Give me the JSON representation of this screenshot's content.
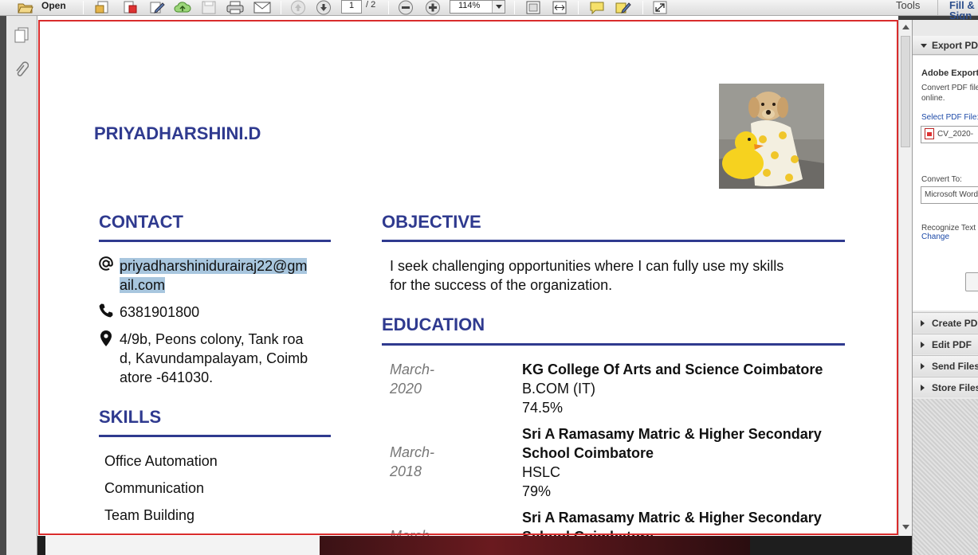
{
  "toolbar": {
    "open_label": "Open",
    "page_current": "1",
    "page_total": "/ 2",
    "zoom": "114%",
    "tools_label": "Tools",
    "fill_label": "Fill & Sign"
  },
  "cv": {
    "name": "PRIYADHARSHINI.D",
    "contact": {
      "title": "CONTACT",
      "email_line1": "priyadharshinidurairaj22@gm",
      "email_line2": "ail.com",
      "phone": "6381901800",
      "address_line1": "4/9b, Peons colony, Tank roa",
      "address_line2": "d, Kavundampalayam, Coimb",
      "address_line3": "atore -641030."
    },
    "skills": {
      "title": "SKILLS",
      "items": [
        "Office Automation",
        "Communication",
        "Team Building"
      ]
    },
    "objective": {
      "title": "OBJECTIVE",
      "line1": "I seek challenging opportunities where I can fully use my skills",
      "line2": "for the success of the organization."
    },
    "education": {
      "title": "EDUCATION",
      "entries": [
        {
          "date_line1": "March-",
          "date_line2": "2020",
          "institution_line1": "KG College Of Arts and Science Coimbatore",
          "institution_line2": "",
          "degree": "B.COM (IT)",
          "score": "74.5%"
        },
        {
          "date_line1": "March-",
          "date_line2": "2018",
          "institution_line1": "Sri A Ramasamy Matric & Higher Secondary",
          "institution_line2": "School Coimbatore",
          "degree": "HSLC",
          "score": "79%"
        },
        {
          "date_line1": "March",
          "date_line2": "",
          "institution_line1": "Sri A Ramasamy Matric & Higher Secondary",
          "institution_line2": "School Coimbatore",
          "degree": "",
          "score": ""
        }
      ]
    }
  },
  "pane": {
    "export_header": "Export PDF",
    "adobe_title": "Adobe ExportPDF",
    "desc_line1": "Convert PDF files",
    "desc_line2": "online.",
    "select_label": "Select PDF File:",
    "file_name": "CV_2020-",
    "convert_to_label": "Convert To:",
    "convert_to_value": "Microsoft Word",
    "recognize_label": "Recognize Text",
    "change_link": "Change",
    "items": [
      "Create PDF",
      "Edit PDF",
      "Send Files",
      "Store Files"
    ]
  },
  "colors": {
    "accent": "#2f3a8f",
    "frame": "#d92c2c",
    "highlight": "#a8c6de"
  }
}
